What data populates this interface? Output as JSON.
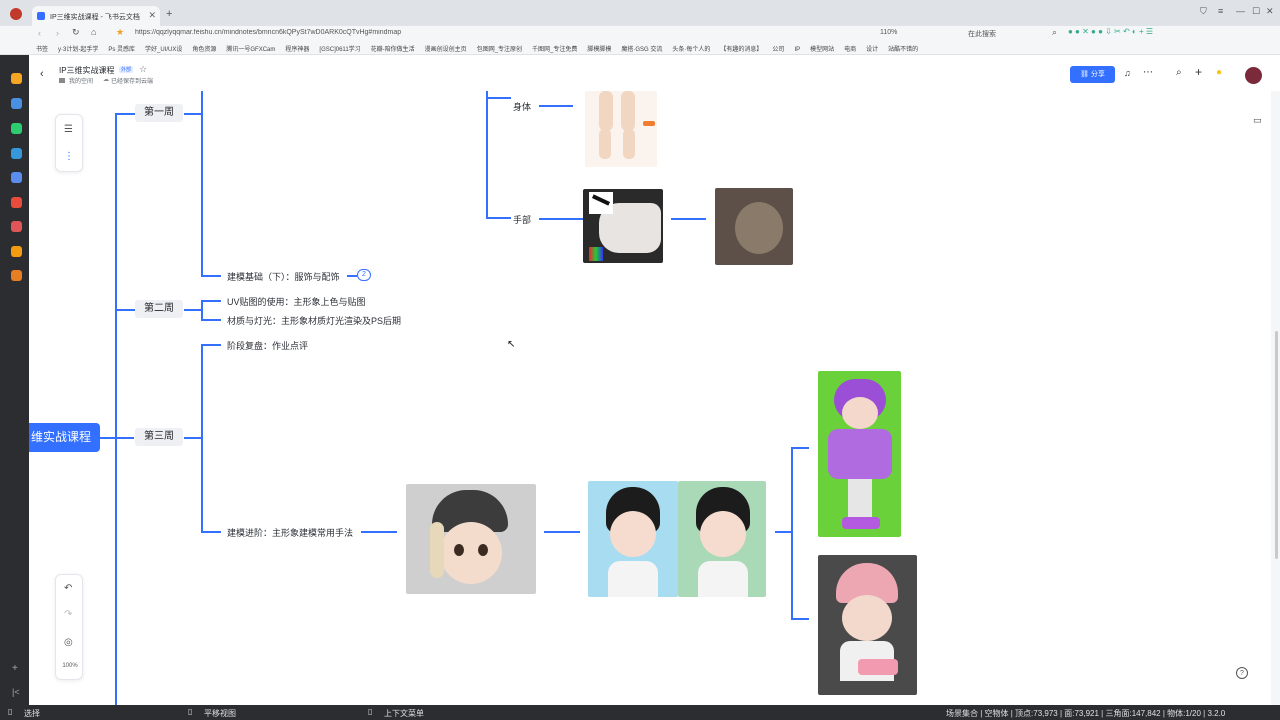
{
  "browser": {
    "tab_title": "IP三维实战课程 - 飞书云文档",
    "url": "https://qqzlyqqmar.feishu.cn/mindnotes/bmncn6kQPySt7wD0ARK0cQTvHg#mindmap",
    "zoom": "110%",
    "search_placeholder": "在此搜索",
    "bookmarks": [
      "书签",
      "y·3计划-起手学",
      "Ps 灵感库",
      "学好_UI/UX设",
      "角色资源",
      "腾讯一号GFXCam",
      "程序神器",
      "[GSC]0611学习",
      "花瓣-陪你做生活",
      "漫画创设创主页",
      "包图网_专注原创",
      "千图网_专注免费",
      "脚模脚模",
      "魔搭·GSG 交流",
      "头条·每个人的",
      "【有趣的消息】",
      "公司",
      "IP",
      "模型网站",
      "电商",
      "设计",
      "站酷不错的"
    ]
  },
  "doc": {
    "title": "IP三维实战课程",
    "badge": "外部",
    "breadcrumb_space": "我的空间",
    "save_status": "已经保存到云端",
    "share_label": "分享"
  },
  "mindmap": {
    "root": "IP三维实战课程",
    "root_visible": "维实战课程",
    "week1": "第一周",
    "week2": "第二周",
    "week3": "第三周",
    "body_label": "身体",
    "hand_label": "手部",
    "modeling_basic_2": "建模基础（下）：服饰与配饰",
    "collapsed_count": "2",
    "uv_mapping": "UV贴图的使用：主形象上色与贴图",
    "material_light": "材质与灯光：主形象材质灯光渲染及PS后期",
    "stage_review": "阶段复盘：作业点评",
    "modeling_advanced": "建模进阶：主形象建模常用手法"
  },
  "zoom_level": "100%",
  "statusbar": {
    "mode": "选择",
    "pan": "平移视图",
    "context_menu": "上下文菜单",
    "stats": "场景集合 | 空物体 | 顶点:73,973 | 面:73,921 | 三角面:147,842 | 物体:1/20 | 3.2.0"
  },
  "colors": {
    "accent": "#3370ff",
    "week_node_bg": "#eef0f3",
    "share_button": "#3370ff"
  }
}
